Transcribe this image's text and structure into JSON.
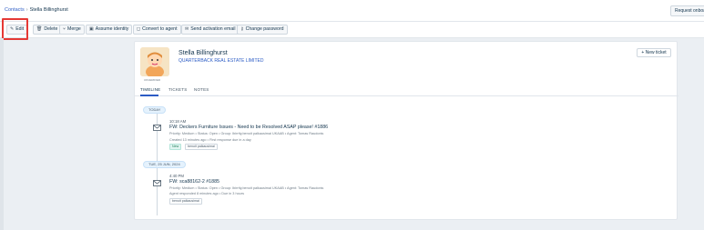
{
  "breadcrumb": {
    "parent": "Contacts",
    "current": "Stella Billinghurst"
  },
  "header": {
    "request_button": "Request onboarding"
  },
  "toolbar": {
    "edit": "Edit",
    "delete": "Delete",
    "merge": "Merge",
    "assume_identity": "Assume identity",
    "convert_to_agent": "Convert to agent",
    "send_activation": "Send activation email",
    "change_password": "Change password"
  },
  "contact": {
    "name": "Stella Billinghurst",
    "company": "QUARTERBACK REAL ESTATE LIMITED",
    "avatar_caption": "UNVERIFIED"
  },
  "new_ticket": "+ New ticket",
  "tabs": [
    "TIMELINE",
    "TICKETS",
    "NOTES"
  ],
  "timeline": [
    {
      "date": "TODAY",
      "time": "10:18 AM",
      "title": "FW: Deckers Furniture Issues - Need to be Resolved ASAP please! #1886",
      "meta": "Priority: Medium • Status: Open • Group: Ibirrtty,benoit palkausimai UKAAB • Agent: Tomas Raudonis",
      "sub": "Created 13 minutes ago • First response due in a day",
      "tags": [
        "New",
        "benoit palkausimai"
      ]
    },
    {
      "date": "TUE, 25 JUN, 2024",
      "time": "4:40 PM",
      "title": "FW: sca88162-2 #1885",
      "meta": "Priority: Medium • Status: Open • Group: Ibirrtty,benoit palkausimai UKAAB • Agent: Tomas Raudonis",
      "sub": "Agent responded 8 minutes ago • Due in 3 hours",
      "tags": [
        "benoit palkausimai"
      ]
    }
  ],
  "colors": {
    "accent": "#2c5cc5",
    "highlight": "#e53935",
    "background": "#ebeff3"
  },
  "icons": [
    "edit-icon",
    "delete-icon",
    "merge-icon",
    "assume-identity-icon",
    "convert-icon",
    "mail-icon",
    "password-icon",
    "envelope-icon"
  ]
}
